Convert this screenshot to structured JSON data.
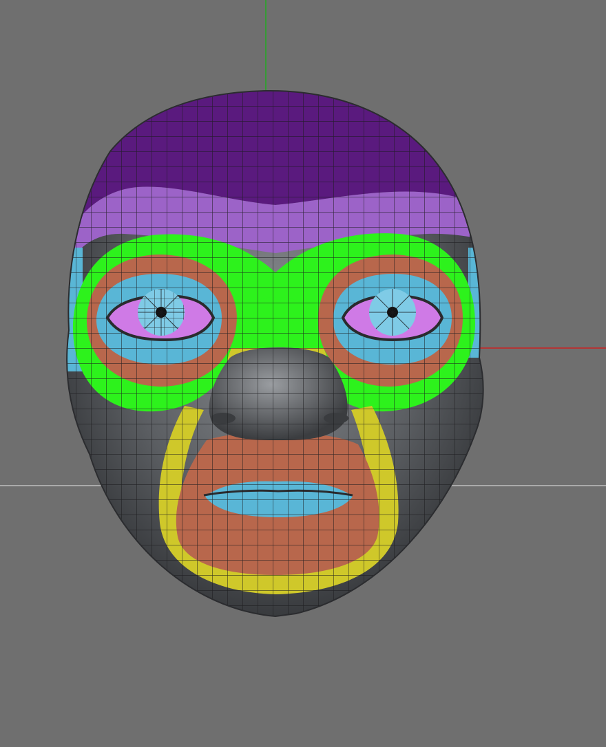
{
  "viewport": {
    "background": "#6f6f6f",
    "axis_colors": {
      "y_axis": "#22aa22",
      "x_axis": "#cc2222",
      "ground_plane": "#bdbdbd"
    }
  },
  "model": {
    "mesh_color": "#5f6266",
    "wire_color": "#1b1b1d",
    "topology_bands": [
      {
        "region": "crown",
        "color": "#5a1a7e"
      },
      {
        "region": "forehead",
        "color": "#9c63c8"
      },
      {
        "region": "brow-ring",
        "color": "#2df21c"
      },
      {
        "region": "orbit-outer",
        "color": "#b8674c"
      },
      {
        "region": "orbit-inner",
        "color": "#59b6d6"
      },
      {
        "region": "eyelid",
        "color": "#cf7ae6"
      },
      {
        "region": "eyeball",
        "color": "#7fcbe6"
      },
      {
        "region": "nasal-bridge",
        "color": "#2df21c"
      },
      {
        "region": "nose-bridge-lower",
        "color": "#cfc82a"
      },
      {
        "region": "nasolabial",
        "color": "#cfc82a"
      },
      {
        "region": "mouth-ring",
        "color": "#b8674c"
      },
      {
        "region": "mouth-inner",
        "color": "#59b6d6"
      }
    ]
  }
}
